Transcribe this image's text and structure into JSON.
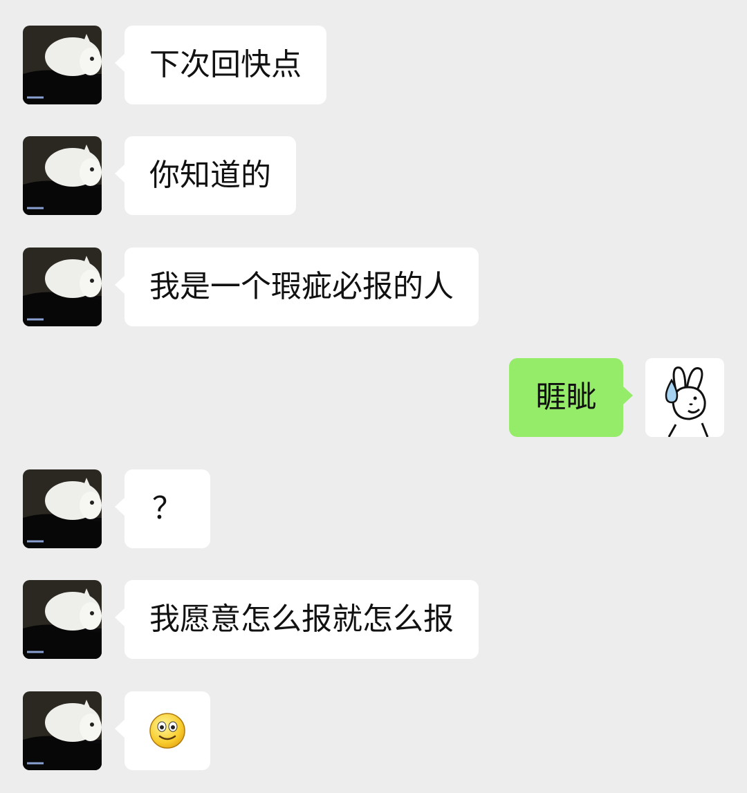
{
  "messages": [
    {
      "side": "left",
      "text": "下次回快点"
    },
    {
      "side": "left",
      "text": "你知道的"
    },
    {
      "side": "left",
      "text": "我是一个瑕疵必报的人"
    },
    {
      "side": "right",
      "text": "睚眦"
    },
    {
      "side": "left",
      "text": "？"
    },
    {
      "side": "left",
      "text": "我愿意怎么报就怎么报"
    },
    {
      "side": "left",
      "emoji": "slight-smile-emoji"
    }
  ],
  "colors": {
    "background": "#ededed",
    "incoming_bubble": "#ffffff",
    "outgoing_bubble": "#95ec69"
  },
  "icons": {
    "incoming_avatar": "white-cat-avatar",
    "outgoing_avatar": "bunny-sweat-drop-avatar",
    "smile_emoji": "slight-smile-emoji"
  }
}
